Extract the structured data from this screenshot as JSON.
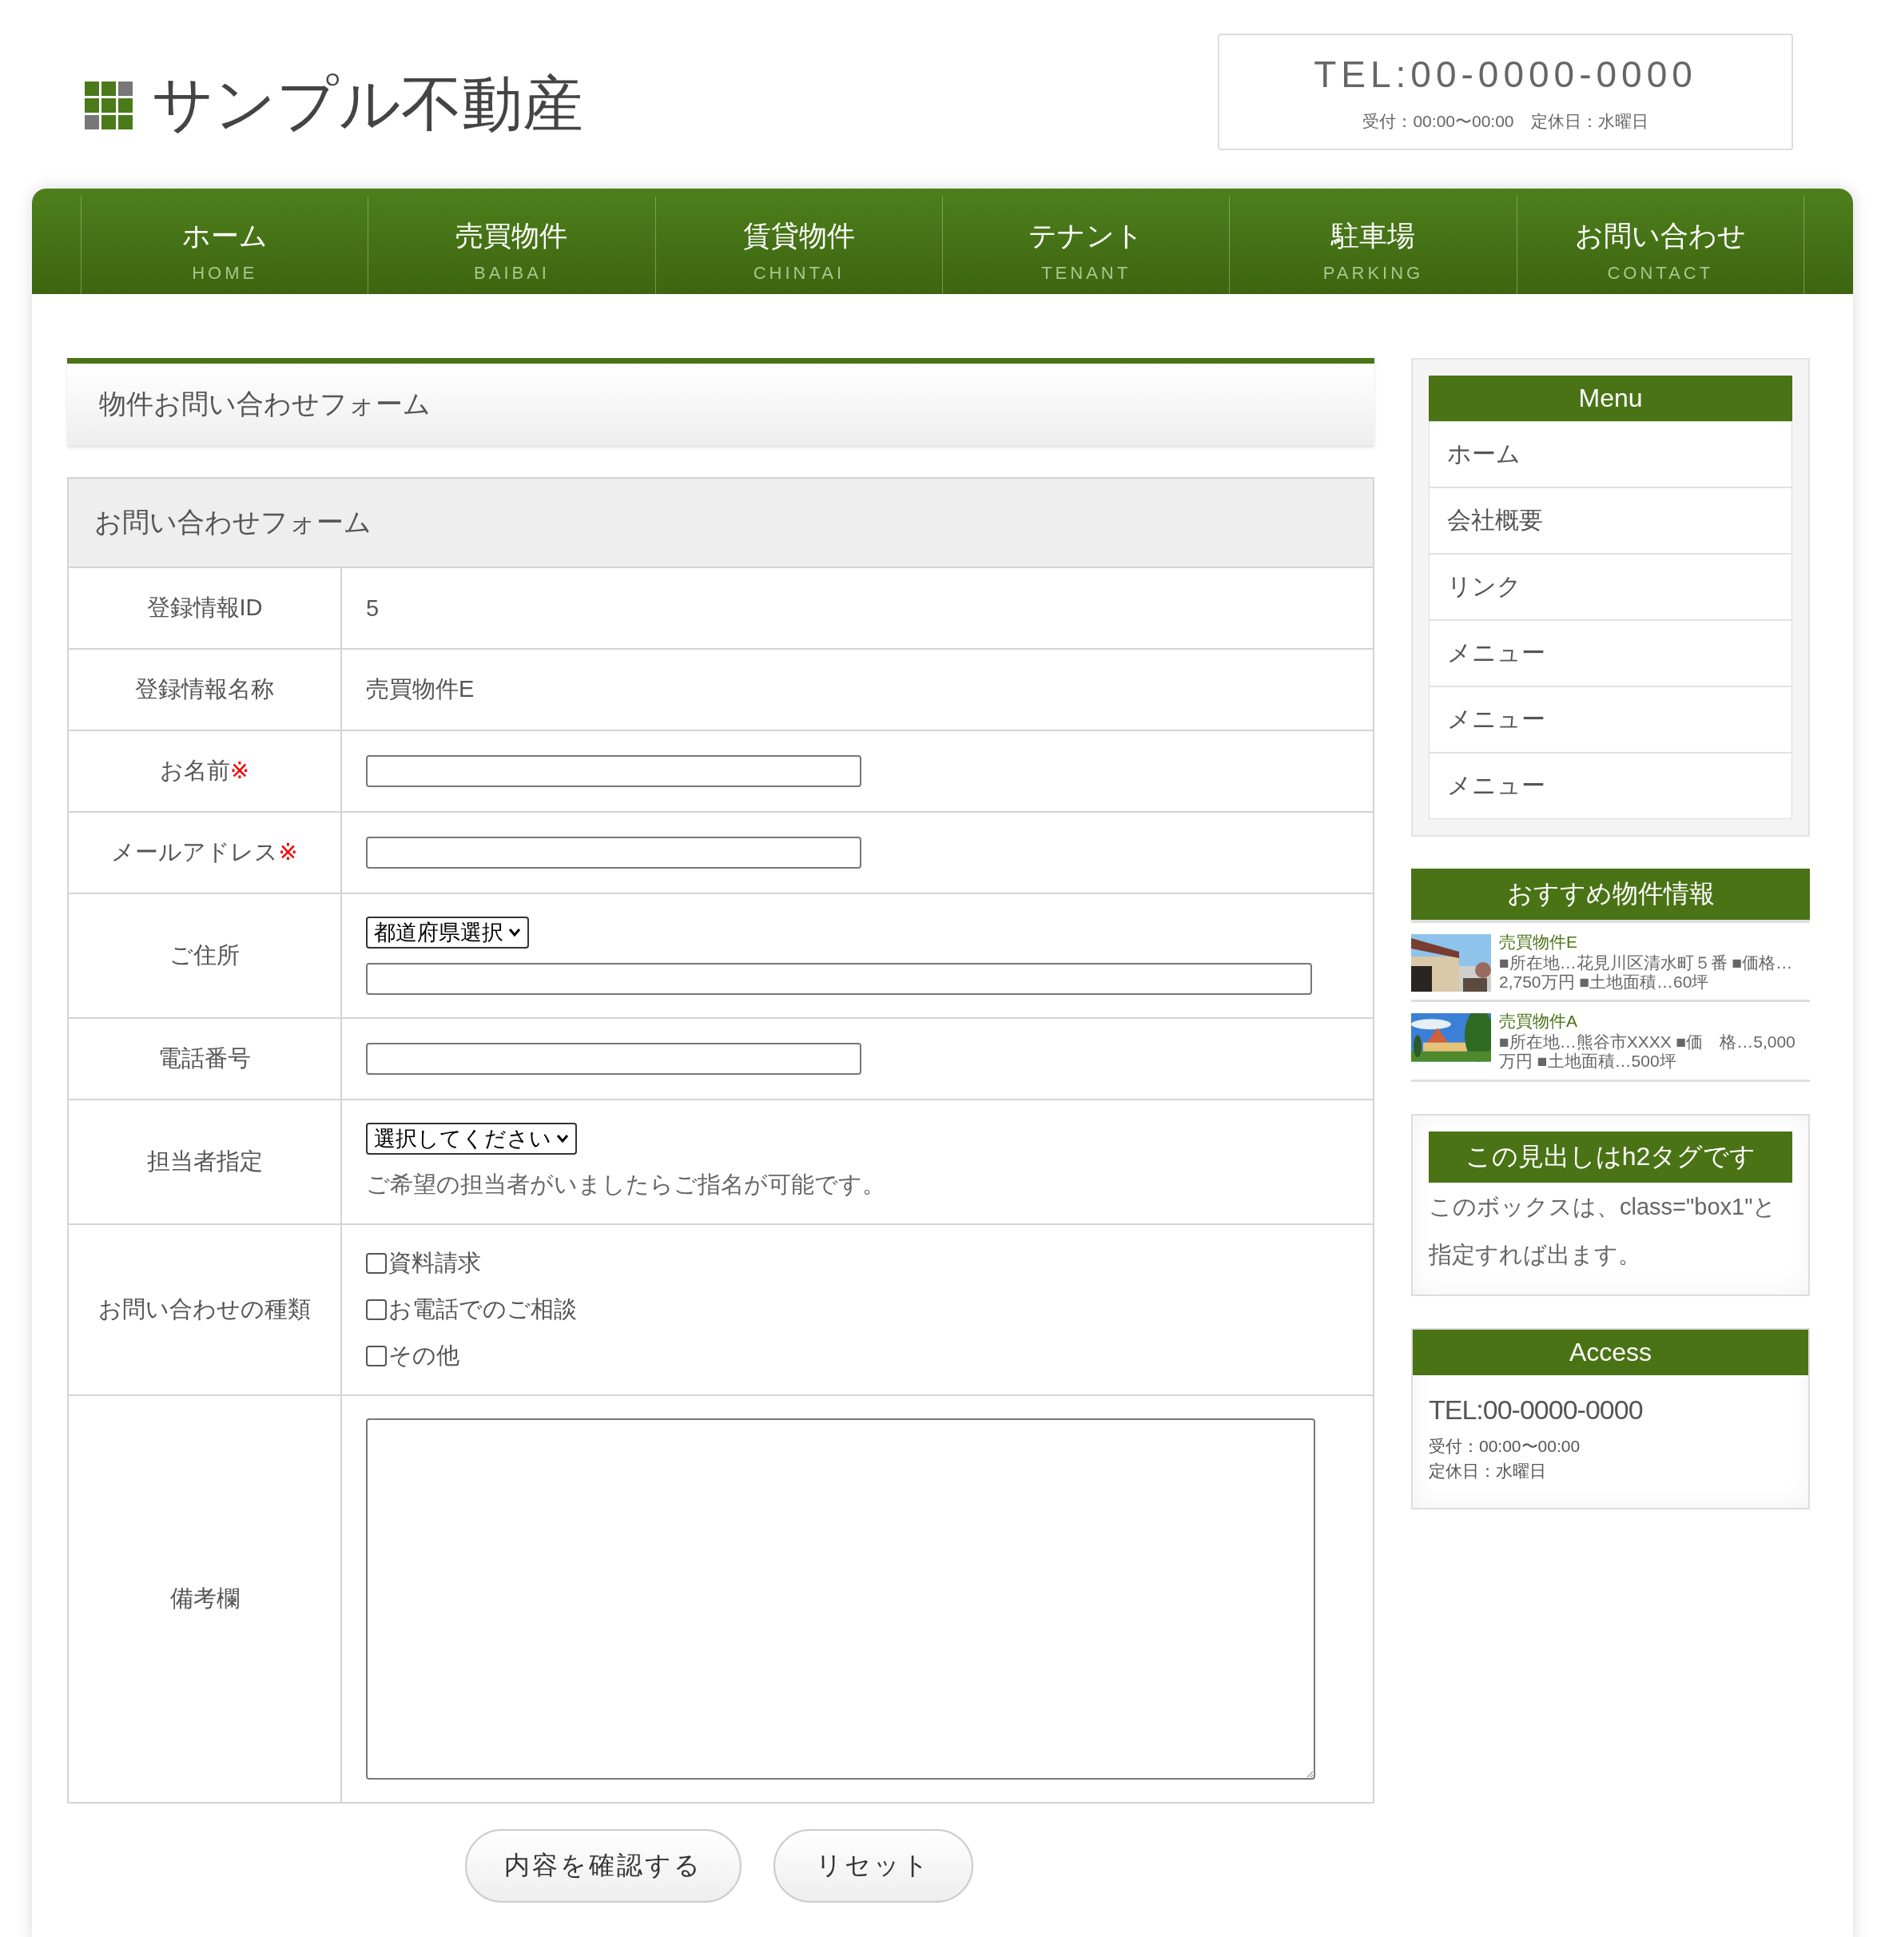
{
  "header": {
    "logo_text": "サンプル不動産",
    "tel": "TEL:00-0000-0000",
    "hours": "受付：00:00〜00:00　定休日：水曜日"
  },
  "nav": [
    {
      "label": "ホーム",
      "sub": "HOME"
    },
    {
      "label": "売買物件",
      "sub": "BAIBAI"
    },
    {
      "label": "賃貸物件",
      "sub": "CHINTAI"
    },
    {
      "label": "テナント",
      "sub": "TENANT"
    },
    {
      "label": "駐車場",
      "sub": "PARKING"
    },
    {
      "label": "お問い合わせ",
      "sub": "CONTACT"
    }
  ],
  "page_title": "物件お問い合わせフォーム",
  "form": {
    "title": "お問い合わせフォーム",
    "rows": [
      {
        "kind": "text",
        "label": "登録情報ID",
        "value": "5"
      },
      {
        "kind": "text",
        "label": "登録情報名称",
        "value": "売買物件E"
      },
      {
        "kind": "input",
        "label": "お名前",
        "required_mark": "※"
      },
      {
        "kind": "input",
        "label": "メールアドレス",
        "required_mark": "※"
      },
      {
        "kind": "address",
        "label": "ご住所",
        "select": "都道府県選択"
      },
      {
        "kind": "input",
        "label": "電話番号"
      },
      {
        "kind": "select_note",
        "label": "担当者指定",
        "select": "選択してください",
        "note": "ご希望の担当者がいましたらご指名が可能です。"
      },
      {
        "kind": "checkboxes",
        "label": "お問い合わせの種類",
        "options": [
          {
            "label": "資料請求",
            "checked": false
          },
          {
            "label": "お電話でのご相談",
            "checked": false
          },
          {
            "label": "その他",
            "checked": false
          }
        ]
      },
      {
        "kind": "textarea",
        "label": "備考欄"
      }
    ],
    "buttons": [
      "内容を確認する",
      "リセット"
    ]
  },
  "sidebar": {
    "menu_title": "Menu",
    "menu_items": [
      "ホーム",
      "会社概要",
      "リンク",
      "メニュー",
      "メニュー",
      "メニュー"
    ],
    "recommended_title": "おすすめ物件情報",
    "recommended": [
      {
        "title": "売買物件E",
        "details": "■所在地…花見川区清水町５番 ■価格…2,750万円 ■土地面積…60坪"
      },
      {
        "title": "売買物件A",
        "details": "■所在地…熊谷市XXXX ■価　格…5,000万円 ■土地面積…500坪"
      }
    ],
    "box_title": "この見出しはh2タグです",
    "box_text": "このボックスは、class=\"box1\"と指定すれば出ます。",
    "access_title": "Access",
    "access_tel": "TEL:00-0000-0000",
    "access_hours": "受付：00:00〜00:00",
    "access_holiday": "定休日：水曜日"
  }
}
